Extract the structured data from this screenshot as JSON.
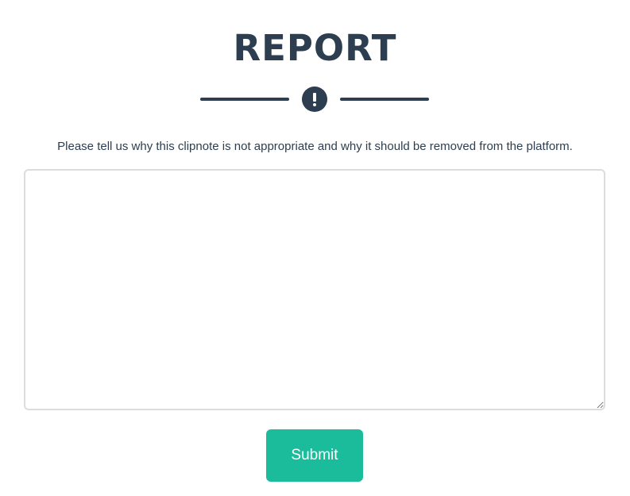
{
  "header": {
    "title": "REPORT",
    "icon": "exclamation-circle-icon"
  },
  "form": {
    "instruction": "Please tell us why this clipnote is not appropriate and why it should be removed from the platform.",
    "reason_value": "",
    "submit_label": "Submit"
  },
  "colors": {
    "heading": "#2c3e50",
    "accent": "#1abc9c",
    "textarea_border": "#dcdcdc"
  }
}
